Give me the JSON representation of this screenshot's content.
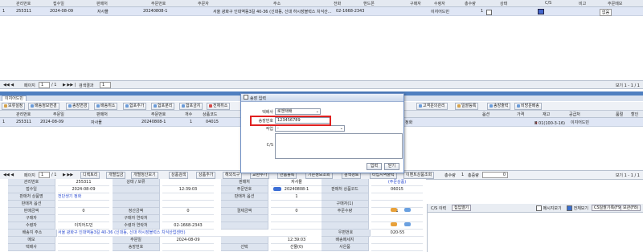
{
  "top_grid": {
    "headers": [
      "관리번호",
      "접수일",
      "판매처",
      "주문번호",
      "주문자",
      "주소",
      "전화",
      "핸드폰",
      "구매자",
      "수령자",
      "총수량",
      "상태",
      "C/S",
      "비고",
      "주문메모"
    ],
    "row": {
      "index": "1",
      "id": "255311",
      "date": "2024-08-09",
      "seller": "자사몰",
      "order_no": "20240808-1",
      "address": "서울 광화구 인대역동3길 40-36 (신대동, 신대 하시장블럭스 치식산...",
      "phone": "02-1668-2343",
      "mobile": "",
      "buyer": "이지어드민",
      "qty": "1",
      "memo": "없음"
    },
    "pager": {
      "page_label": "페이지",
      "page_value": "1",
      "of_label": "/ 1",
      "size_label": "검색결과",
      "size_value": "1",
      "right": "보기 1 - 1 / 1"
    }
  },
  "tabs": [
    "이지어드민"
  ],
  "toolbar": [
    {
      "label": "보류설정",
      "color": "#d5a24a"
    },
    {
      "label": "배송정보변경",
      "color": "#6a9bd8"
    },
    {
      "label": "송장변경",
      "color": "#6a9bd8"
    },
    {
      "label": "배송취소",
      "color": "#6a9bd8"
    },
    {
      "label": "합포추가",
      "color": "#6a9bd8"
    },
    {
      "label": "합포분리",
      "color": "#6a9bd8"
    },
    {
      "label": "합포금지",
      "color": "#6a9bd8"
    },
    {
      "label": "전체취소",
      "color": "#d24a4a"
    },
    {
      "label": "고객문의관리",
      "color": "#6a9bd8"
    },
    {
      "label": "일괄등록",
      "color": "#d5a24a"
    },
    {
      "label": "송장출력",
      "color": "#6a9bd8"
    },
    {
      "label": "비방문배송",
      "color": "#6a9bd8"
    }
  ],
  "grid2": {
    "headers": [
      "관리번호",
      "주문일",
      "판매처",
      "주문번호",
      "개수",
      "상품코드",
      "옵션",
      "가격",
      "재고",
      "공급처",
      "품절",
      "할인"
    ],
    "row": {
      "index": "1",
      "id": "255311",
      "date": "2024-08-09",
      "seller": "자사몰",
      "order_no": "20240808-1",
      "qty": "1",
      "code": "04015",
      "status": "정화",
      "option": "X 01(100-3-16)",
      "supplier": "이지어드민"
    }
  },
  "dialog": {
    "title": "송장 입력",
    "carrier_label": "택배사",
    "carrier_value": "로젠택배",
    "invoice_label": "송장번호",
    "invoice_value": "123456789",
    "work_label": "작업",
    "work_value": "-",
    "cs_label": "C/S",
    "ok": "입력",
    "close": "닫기"
  },
  "bottom_toolbar": {
    "page_label": "페이지",
    "page_value": "1",
    "of_label": "/ 1",
    "buttons": [
      "디렉토리",
      "개별입금",
      "개별정산보기",
      "상품검색",
      "상품추가",
      "해외직구",
      "교환추가",
      "반품등록",
      "기존정보조회",
      "검색경로",
      "타입지역출력",
      "이벤트상품조회"
    ],
    "total_label": "총수량",
    "total_value": "1",
    "weight_label": "총중량",
    "weight_value": "0",
    "right_label": "보기 1 - 1 / 1"
  },
  "detail": {
    "side": "주문정보",
    "rows": [
      [
        {
          "l": "관리번호",
          "v": "255311"
        },
        {
          "l": "상태 / 보류",
          "v": ""
        },
        {
          "l": "판매처",
          "v": "자사몰"
        },
        {
          "l": "",
          "v": "(주문상품)"
        }
      ],
      [
        {
          "l": "접수일",
          "v": "2024-08-09"
        },
        {
          "l": "",
          "v": "12:39:03"
        },
        {
          "l": "주문번호",
          "v": "20240808-1"
        },
        {
          "l": "판매처 상품코드",
          "v": "06015"
        }
      ],
      [
        {
          "l": "판매처 상품명",
          "v": "전단생기 정화"
        },
        {
          "l": "",
          "v": ""
        },
        {
          "l": "판매처 옵션",
          "v": "1"
        },
        {
          "l": "",
          "v": ""
        }
      ],
      [
        {
          "l": "판매처 옵션",
          "v": ""
        },
        {
          "l": "",
          "v": ""
        },
        {
          "l": "",
          "v": ""
        },
        {
          "l": "구매자(1)",
          "v": ""
        }
      ],
      [
        {
          "l": "판매금액",
          "v": "0"
        },
        {
          "l": "정산금액",
          "v": "0"
        },
        {
          "l": "결제금액",
          "v": "0"
        },
        {
          "l": "주문수량",
          "v": "1"
        }
      ],
      [
        {
          "l": "구매자",
          "v": ""
        },
        {
          "l": "구매자 연락처",
          "v": ""
        },
        {
          "l": "",
          "v": ""
        },
        {
          "l": "",
          "v": ""
        }
      ],
      [
        {
          "l": "수령자",
          "v": "이지어드민"
        },
        {
          "l": "수령자 연락처",
          "v": "02-1668-2343"
        },
        {
          "l": "",
          "v": ""
        },
        {
          "l": "",
          "v": ""
        }
      ],
      [
        {
          "l": "배송지 주소",
          "v": "서울 광화구 인대역동3길 40-36 (신대동, 신대 하시장블럭스 치식산업센터)"
        },
        {
          "l": "우편번호",
          "v": "020-55"
        }
      ],
      [
        {
          "l": "메모",
          "v": ""
        },
        {
          "l": "주문일",
          "v": "2024-08-09"
        },
        {
          "l": "",
          "v": "12:39:03"
        },
        {
          "l": "배송메세지",
          "v": ""
        }
      ],
      [
        {
          "l": "택배사",
          "v": ""
        },
        {
          "l": "송장번호",
          "v": ""
        },
        {
          "l": "선택",
          "v": "선물(0)"
        },
        {
          "l": "사은품",
          "v": ""
        }
      ]
    ]
  },
  "right_panel": {
    "title": "C/S 이력",
    "btn_open": "집입열기",
    "chk1": "메시지보기",
    "chk2": "전체보기",
    "btn1": "CS일괄기록(F9)",
    "btn2": "보관(F8)"
  }
}
